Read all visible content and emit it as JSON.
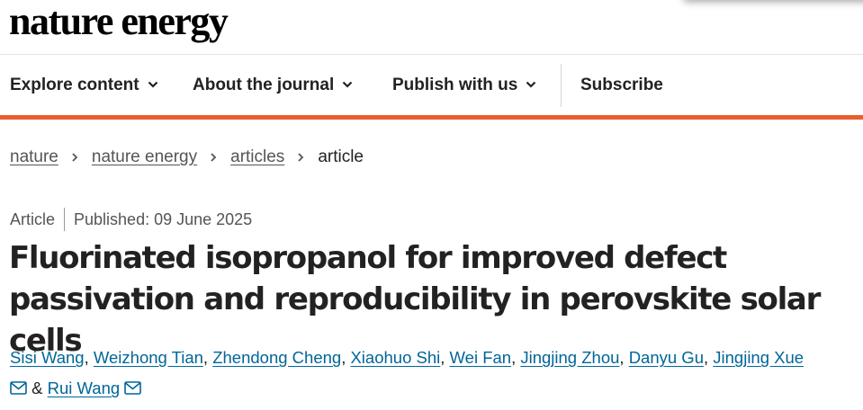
{
  "site": {
    "logo": "nature energy"
  },
  "nav": {
    "items": [
      {
        "label": "Explore content"
      },
      {
        "label": "About the journal"
      },
      {
        "label": "Publish with us"
      }
    ],
    "subscribe": "Subscribe",
    "accent_color": "#e95e2e"
  },
  "breadcrumb": {
    "items": [
      {
        "label": "nature"
      },
      {
        "label": "nature energy"
      },
      {
        "label": "articles"
      }
    ],
    "current": "article"
  },
  "article": {
    "type": "Article",
    "published": "Published: 09 June 2025",
    "title": "Fluorinated isopropanol for improved defect passivation and reproducibility in perovskite solar cells",
    "authors": [
      "Sisi Wang",
      "Weizhong Tian",
      "Zhendong Cheng",
      "Xiaohuo Shi",
      "Wei Fan",
      "Jingjing Zhou",
      "Danyu Gu",
      "Jingjing Xue",
      "Rui Wang"
    ],
    "author_separator": ",",
    "author_conjunction": "&",
    "link_color": "#006699",
    "icons": [
      "chevron-down-icon",
      "chevron-right-icon",
      "mail-icon"
    ]
  }
}
